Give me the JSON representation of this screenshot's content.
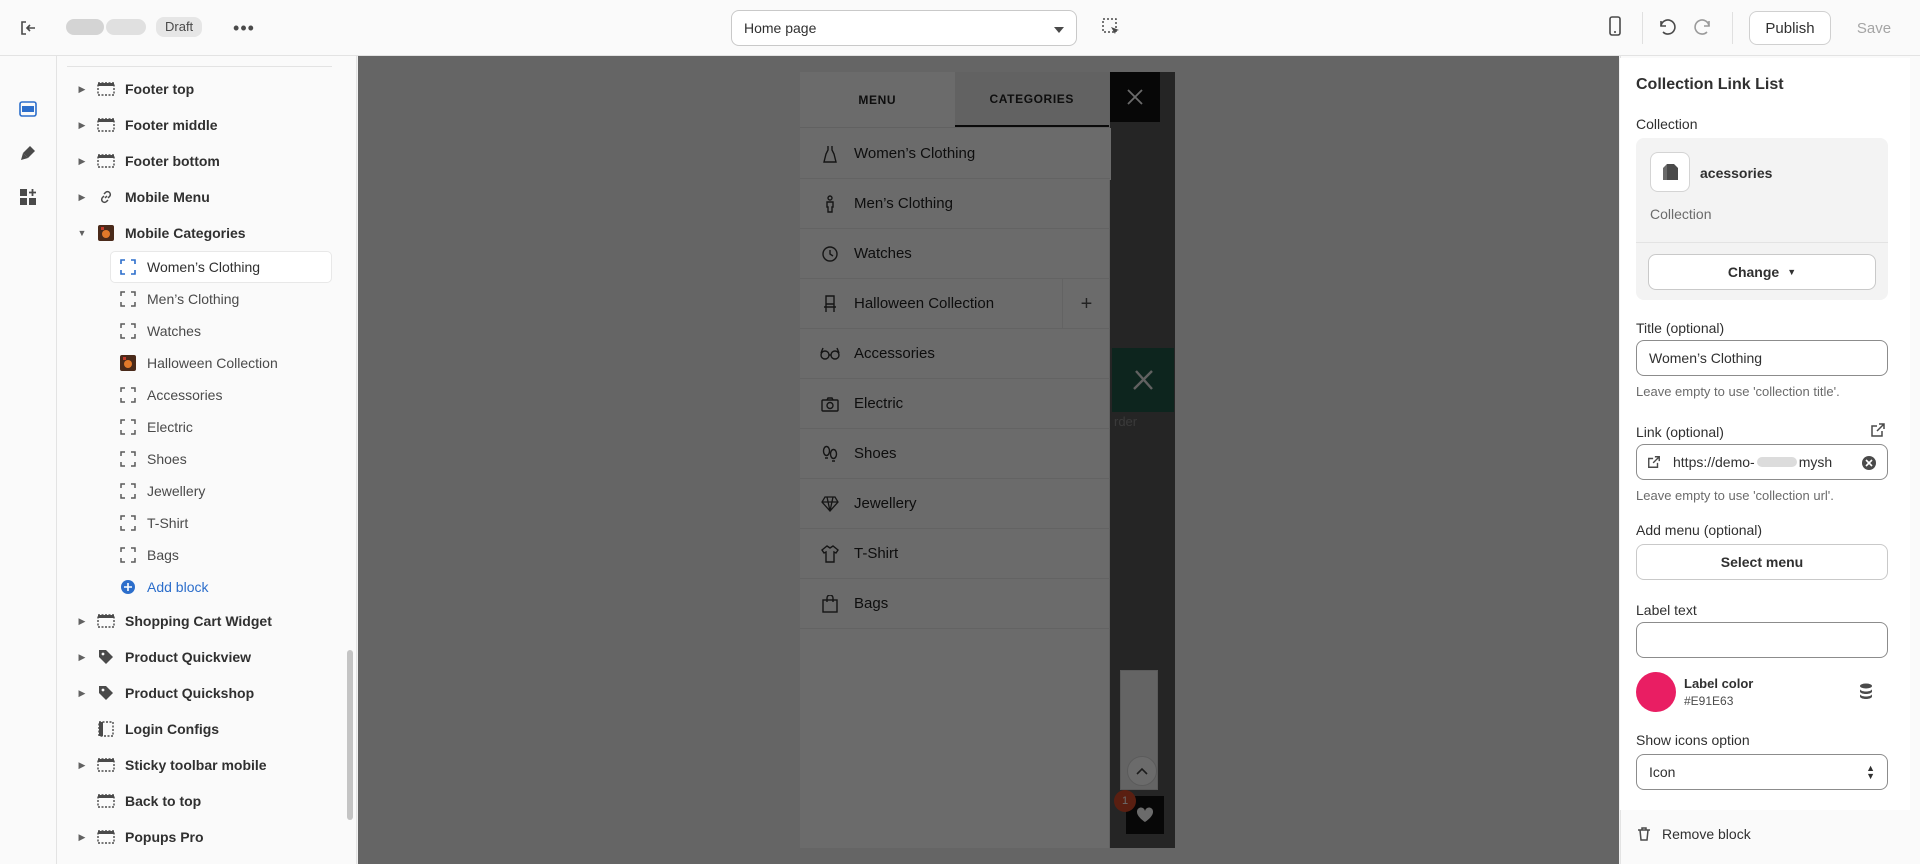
{
  "topbar": {
    "status_badge": "Draft",
    "more_label": "•••",
    "template_select": "Home page",
    "publish_label": "Publish",
    "save_label": "Save"
  },
  "sidebar": {
    "sections_before": [
      {
        "label": "Footer top",
        "icon": "section-icon"
      },
      {
        "label": "Footer middle",
        "icon": "section-icon"
      },
      {
        "label": "Footer bottom",
        "icon": "section-icon"
      },
      {
        "label": "Mobile Menu",
        "icon": "link-icon"
      },
      {
        "label": "Mobile Categories",
        "icon": "halloween-image-icon",
        "expanded": true
      }
    ],
    "blocks": [
      {
        "label": "Women’s Clothing",
        "icon": "block-icon",
        "active": true
      },
      {
        "label": "Men’s Clothing",
        "icon": "block-icon"
      },
      {
        "label": "Watches",
        "icon": "block-icon"
      },
      {
        "label": "Halloween Collection",
        "icon": "halloween-image-icon"
      },
      {
        "label": "Accessories",
        "icon": "block-icon"
      },
      {
        "label": "Electric",
        "icon": "block-icon"
      },
      {
        "label": "Shoes",
        "icon": "block-icon"
      },
      {
        "label": "Jewellery",
        "icon": "block-icon"
      },
      {
        "label": "T-Shirt",
        "icon": "block-icon"
      },
      {
        "label": "Bags",
        "icon": "block-icon"
      }
    ],
    "add_block_label": "Add block",
    "sections_after": [
      {
        "label": "Shopping Cart Widget",
        "icon": "section-icon",
        "caret": true
      },
      {
        "label": "Product Quickview",
        "icon": "tag-icon",
        "caret": true
      },
      {
        "label": "Product Quickshop",
        "icon": "tag-icon",
        "caret": true
      },
      {
        "label": "Login Configs",
        "icon": "sidebar-layout-icon",
        "caret": false
      },
      {
        "label": "Sticky toolbar mobile",
        "icon": "section-icon",
        "caret": true
      },
      {
        "label": "Back to top",
        "icon": "section-icon",
        "caret": false
      },
      {
        "label": "Popups Pro",
        "icon": "section-icon",
        "caret": true
      }
    ]
  },
  "preview": {
    "tabs": [
      "MENU",
      "CATEGORIES"
    ],
    "active_tab": "CATEGORIES",
    "under_text": "rder",
    "cart_count": "1",
    "categories": [
      {
        "label": "Women’s Clothing",
        "icon": "dress-icon"
      },
      {
        "label": "Men’s Clothing",
        "icon": "man-icon"
      },
      {
        "label": "Watches",
        "icon": "clock-icon"
      },
      {
        "label": "Halloween Collection",
        "icon": "chair-icon",
        "has_plus": true
      },
      {
        "label": "Accessories",
        "icon": "glasses-icon"
      },
      {
        "label": "Electric",
        "icon": "camera-icon"
      },
      {
        "label": "Shoes",
        "icon": "footprints-icon"
      },
      {
        "label": "Jewellery",
        "icon": "diamond-icon"
      },
      {
        "label": "T-Shirt",
        "icon": "shirt-icon"
      },
      {
        "label": "Bags",
        "icon": "bag-icon"
      }
    ]
  },
  "settings": {
    "title": "Collection Link List",
    "collection_label": "Collection",
    "collection_name": "acessories",
    "collection_type": "Collection",
    "change_label": "Change",
    "title_label": "Title (optional)",
    "title_value": "Women’s Clothing",
    "title_help": "Leave empty to use 'collection title'.",
    "link_label": "Link (optional)",
    "link_value": "https://demo-",
    "link_value_end": "mysh",
    "link_help": "Leave empty to use 'collection url'.",
    "add_menu_label": "Add menu (optional)",
    "select_menu_label": "Select menu",
    "label_text_label": "Label text",
    "label_text_value": "",
    "label_color_label": "Label color",
    "label_color_hex": "#E91E63",
    "show_icons_label": "Show icons option",
    "show_icons_value": "Icon",
    "remove_label": "Remove block"
  },
  "colors": {
    "accent_blue": "#2c6ecb",
    "label_color": "#E91E63",
    "preview_green": "#1f5a48"
  }
}
